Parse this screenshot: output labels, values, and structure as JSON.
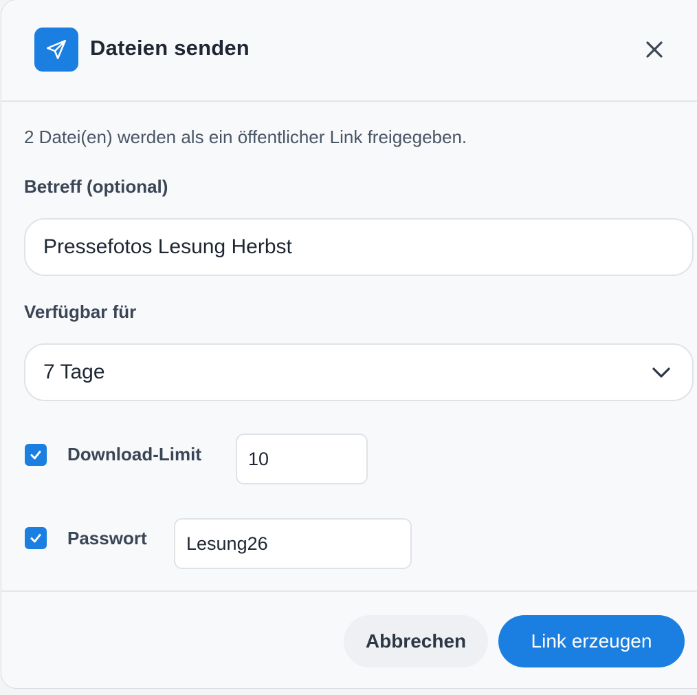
{
  "dialog": {
    "title": "Dateien senden",
    "header_icon": "paper-plane-icon",
    "close_icon": "close-icon",
    "intro_text": "2 Datei(en) werden als ein öffentlicher Link freigegeben."
  },
  "subject": {
    "label": "Betreff (optional)",
    "value": "Pressefotos Lesung Herbst"
  },
  "availability": {
    "label": "Verfügbar für",
    "selected": "7 Tage",
    "chevron_icon": "chevron-down-icon"
  },
  "download_limit": {
    "label": "Download-Limit",
    "checked": true,
    "value": "10"
  },
  "password": {
    "label": "Passwort",
    "checked": true,
    "value": "Lesung26"
  },
  "footer": {
    "cancel_label": "Abbrechen",
    "submit_label": "Link erzeugen"
  },
  "colors": {
    "accent": "#1a7fe0",
    "background": "#f8f9fb",
    "text": "#1f2733"
  }
}
